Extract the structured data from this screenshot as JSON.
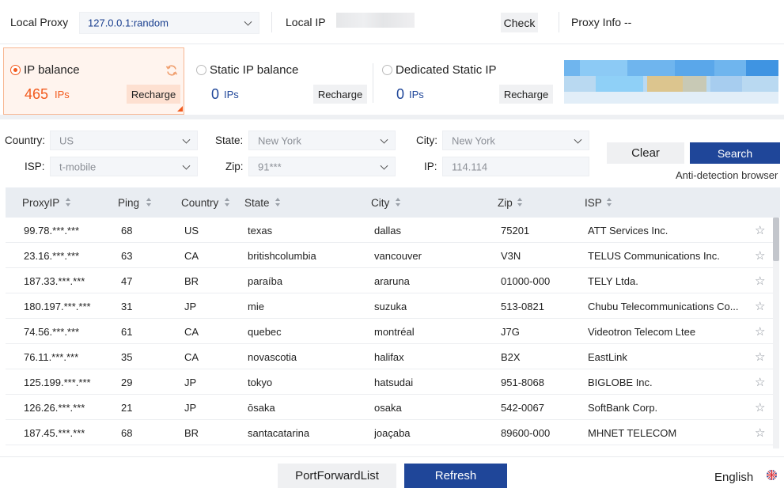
{
  "top": {
    "local_proxy_label": "Local Proxy",
    "local_proxy_value": "127.0.0.1:random",
    "local_ip_label": "Local IP",
    "check_label": "Check",
    "proxy_info_label": "Proxy Info",
    "proxy_info_value": "--"
  },
  "balance": {
    "ip": {
      "title": "IP balance",
      "value": "465",
      "unit": "IPs",
      "recharge": "Recharge"
    },
    "static": {
      "title": "Static IP balance",
      "value": "0",
      "unit": "IPs",
      "recharge": "Recharge"
    },
    "dedicated": {
      "title": "Dedicated Static IP",
      "value": "0",
      "unit": "IPs",
      "recharge": "Recharge"
    }
  },
  "filters": {
    "country_label": "Country:",
    "country_value": "US",
    "state_label": "State:",
    "state_value": "New York",
    "city_label": "City:",
    "city_value": "New York",
    "isp_label": "ISP:",
    "isp_value": "t-mobile",
    "zip_label": "Zip:",
    "zip_value": "91***",
    "ip_label": "IP:",
    "ip_value": "114.114",
    "clear_label": "Clear",
    "search_label": "Search",
    "anti_detection_label": "Anti-detection browser"
  },
  "table": {
    "columns": [
      "ProxyIP",
      "Ping",
      "Country",
      "State",
      "City",
      "Zip",
      "ISP"
    ],
    "rows": [
      [
        "99.78.***.***",
        "68",
        "US",
        "texas",
        "dallas",
        "75201",
        "ATT Services Inc."
      ],
      [
        "23.16.***.***",
        "63",
        "CA",
        "britishcolumbia",
        "vancouver",
        "V3N",
        "TELUS Communications Inc."
      ],
      [
        "187.33.***.***",
        "47",
        "BR",
        "paraíba",
        "araruna",
        "01000-000",
        "TELY Ltda."
      ],
      [
        "180.197.***.***",
        "31",
        "JP",
        "mie",
        "suzuka",
        "513-0821",
        "Chubu Telecommunications Co..."
      ],
      [
        "74.56.***.***",
        "61",
        "CA",
        "quebec",
        "montréal",
        "J7G",
        "Videotron Telecom Ltee"
      ],
      [
        "76.11.***.***",
        "35",
        "CA",
        "novascotia",
        "halifax",
        "B2X",
        "EastLink"
      ],
      [
        "125.199.***.***",
        "29",
        "JP",
        "tokyo",
        "hatsudai",
        "951-8068",
        "BIGLOBE Inc."
      ],
      [
        "126.26.***.***",
        "21",
        "JP",
        "ōsaka",
        "osaka",
        "542-0067",
        "SoftBank Corp."
      ],
      [
        "187.45.***.***",
        "68",
        "BR",
        "santacatarina",
        "joaçaba",
        "89600-000",
        "MHNET TELECOM"
      ]
    ]
  },
  "footer": {
    "port_forward_label": "PortForwardList",
    "refresh_label": "Refresh",
    "language_label": "English"
  },
  "colors": {
    "accent_orange": "#f25a1d",
    "primary_blue": "#1f4699",
    "header_bg": "#e9edf2"
  },
  "icons": [
    "chevron-down-icon",
    "refresh-icon",
    "radio-icon",
    "sort-icon",
    "star-icon",
    "uk-flag-icon"
  ]
}
